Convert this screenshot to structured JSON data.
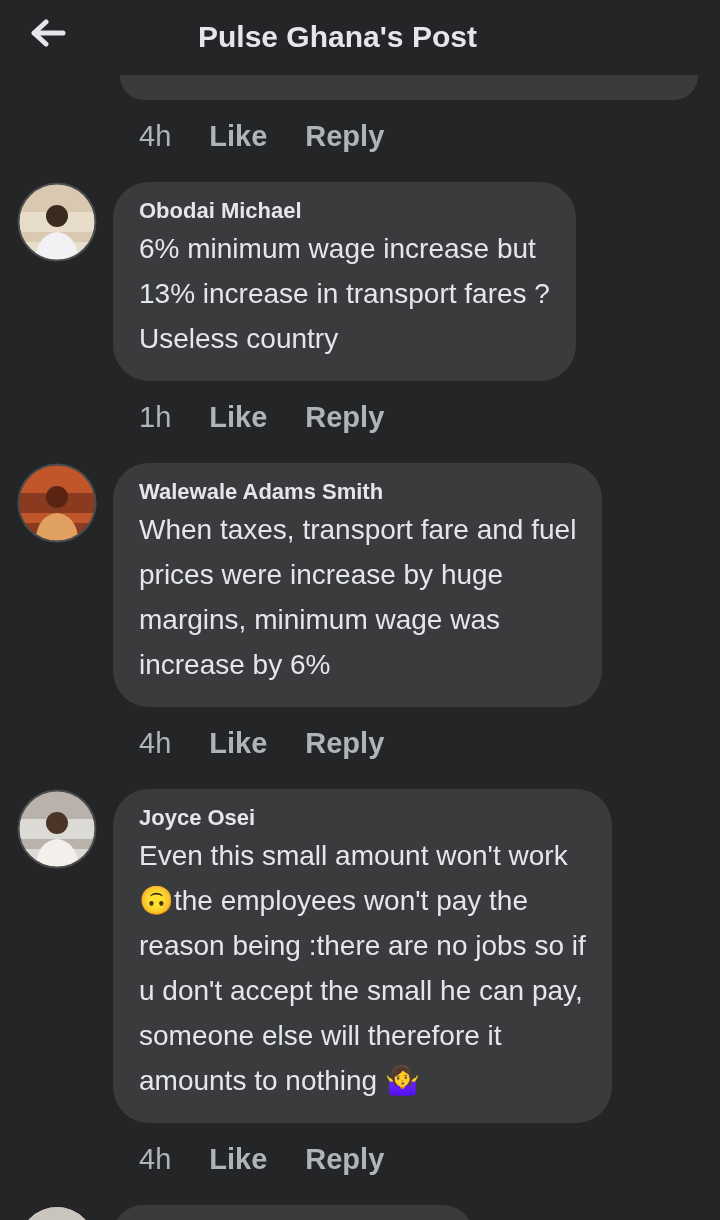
{
  "header": {
    "title": "Pulse Ghana's Post"
  },
  "previous_comment": {
    "time": "4h",
    "actions": [
      "Like",
      "Reply"
    ]
  },
  "comments": [
    {
      "author": "Obodai Michael",
      "avatar": {
        "kind": "picture"
      },
      "text": "6% minimum wage increase but\n13% increase in transport fares ?\nUseless country",
      "time": "1h",
      "actions": [
        "Like",
        "Reply"
      ]
    },
    {
      "author": "Walewale Adams Smith",
      "avatar": {
        "kind": "picture"
      },
      "text": "When taxes, transport fare and fuel\nprices were increase by huge\nmargins, minimum wage was\nincrease by 6%",
      "time": "4h",
      "actions": [
        "Like",
        "Reply"
      ]
    },
    {
      "author": "Joyce Osei",
      "avatar": {
        "kind": "picture"
      },
      "text": "Even this small amount won't work\n🙃the employees won't pay the\nreason being :there are no jobs so if\nu don't accept the small he can pay,\nsomeone else will therefore it\namounts to nothing 🤷‍♀️",
      "time": "4h",
      "actions": [
        "Like",
        "Reply"
      ]
    }
  ],
  "more_comments_below": true
}
